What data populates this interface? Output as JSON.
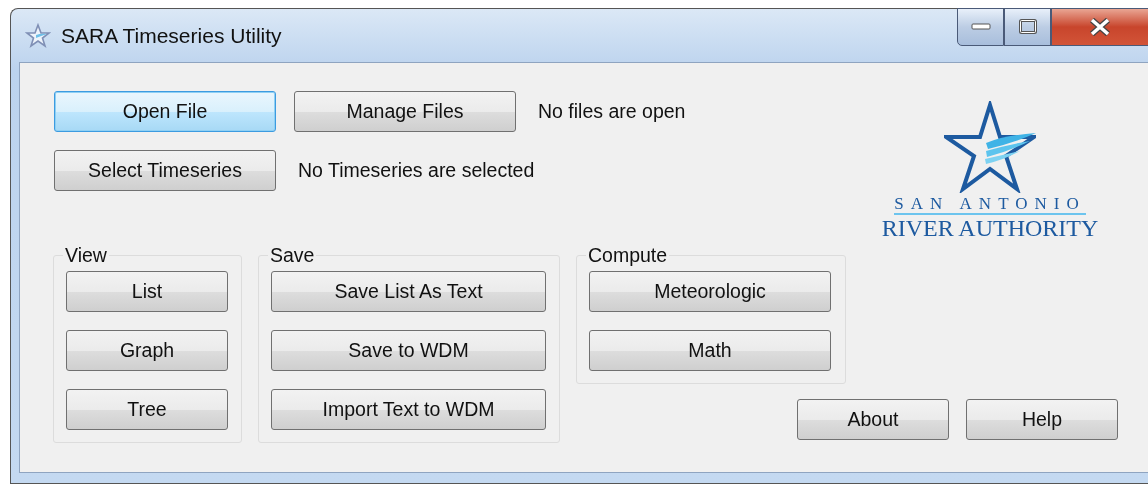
{
  "window": {
    "title": "SARA Timeseries Utility"
  },
  "top_rows": [
    {
      "buttons": [
        {
          "label": "Open File",
          "focused": true
        },
        {
          "label": "Manage Files",
          "focused": false
        }
      ],
      "status": "No files are open"
    },
    {
      "buttons": [
        {
          "label": "Select Timeseries",
          "focused": false
        }
      ],
      "status": "No Timeseries are selected"
    }
  ],
  "logo": {
    "line_1": "SAN ANTONIO",
    "line_2": "RIVER AUTHORITY"
  },
  "groups": [
    {
      "title": "View",
      "buttons": [
        {
          "label": "List",
          "focused": false
        },
        {
          "label": "Graph",
          "focused": false
        },
        {
          "label": "Tree",
          "focused": false
        }
      ]
    },
    {
      "title": "Save",
      "buttons": [
        {
          "label": "Save List As Text",
          "focused": false
        },
        {
          "label": "Save to WDM",
          "focused": false
        },
        {
          "label": "Import Text to WDM",
          "focused": false
        }
      ]
    },
    {
      "title": "Compute",
      "buttons": [
        {
          "label": "Meteorologic",
          "focused": false
        },
        {
          "label": "Math",
          "focused": false
        }
      ]
    }
  ],
  "footer_buttons": [
    {
      "label": "About",
      "focused": false
    },
    {
      "label": "Help",
      "focused": false
    }
  ]
}
